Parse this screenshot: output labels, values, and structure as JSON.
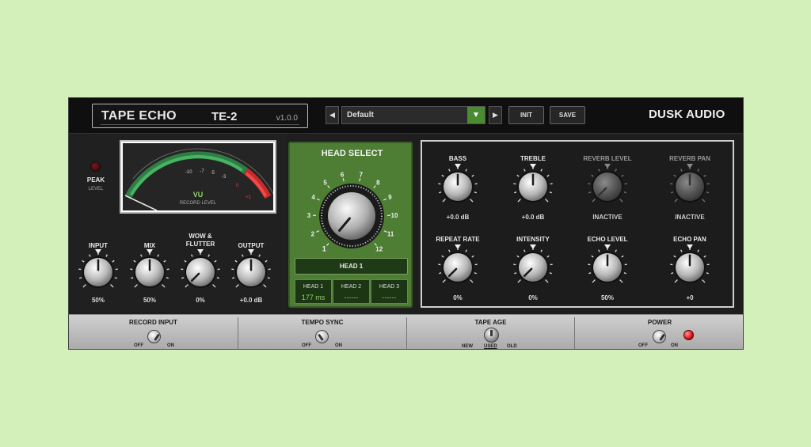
{
  "header": {
    "product_name": "TAPE ECHO",
    "model": "TE-2",
    "version": "v1.0.0",
    "preset_prev_icon": "◀",
    "preset_next_icon": "▶",
    "preset_name": "Default",
    "preset_dropdown_icon": "▼",
    "init_label": "INIT",
    "save_label": "SAVE",
    "brand": "DUSK AUDIO"
  },
  "meter": {
    "peak_label": "PEAK",
    "level_label": "LEVEL",
    "vu_label": "VU",
    "record_level_label": "RECORD LEVEL",
    "scale": [
      "-10",
      "-7",
      "-5",
      "-3",
      "0",
      "+1"
    ],
    "needle_level": 0.0
  },
  "left_knobs": [
    {
      "label": "INPUT",
      "value": "50%",
      "level": 0.5
    },
    {
      "label": "MIX",
      "value": "50%",
      "level": 0.5
    },
    {
      "label": "WOW &\nFLUTTER",
      "value": "0%",
      "level": 0.0
    },
    {
      "label": "OUTPUT",
      "value": "+0.0 dB",
      "level": 0.5
    }
  ],
  "head_select": {
    "title": "HEAD SELECT",
    "numbers": [
      "1",
      "2",
      "3",
      "4",
      "5",
      "6",
      "7",
      "8",
      "9",
      "10",
      "11",
      "12"
    ],
    "selected_label": "HEAD 1",
    "heads": [
      {
        "label": "HEAD 1",
        "value": "177 ms"
      },
      {
        "label": "HEAD 2",
        "value": "------"
      },
      {
        "label": "HEAD 3",
        "value": "------"
      }
    ]
  },
  "right_knobs": [
    {
      "label": "BASS",
      "value": "+0.0 dB",
      "level": 0.5,
      "active": true
    },
    {
      "label": "TREBLE",
      "value": "+0.0 dB",
      "level": 0.5,
      "active": true
    },
    {
      "label": "REVERB LEVEL",
      "value": "INACTIVE",
      "level": 0.0,
      "active": false
    },
    {
      "label": "REVERB PAN",
      "value": "INACTIVE",
      "level": 0.5,
      "active": false
    },
    {
      "label": "REPEAT RATE",
      "value": "0%",
      "level": 0.0,
      "active": true
    },
    {
      "label": "INTENSITY",
      "value": "0%",
      "level": 0.0,
      "active": true
    },
    {
      "label": "ECHO LEVEL",
      "value": "50%",
      "level": 0.5,
      "active": true
    },
    {
      "label": "ECHO PAN",
      "value": "+0",
      "level": 0.5,
      "active": true
    }
  ],
  "bottom": {
    "record_input": {
      "label": "RECORD INPUT",
      "off": "OFF",
      "on": "ON"
    },
    "tempo_sync": {
      "label": "TEMPO SYNC",
      "off": "OFF",
      "on": "ON"
    },
    "tape_age": {
      "label": "TAPE AGE",
      "new": "NEW",
      "used": "USED",
      "old": "OLD"
    },
    "power": {
      "label": "POWER",
      "off": "OFF",
      "on": "ON"
    }
  },
  "colors": {
    "accent_green": "#4e7d34",
    "meter_green": "#3fa85a",
    "meter_red": "#e03a3a",
    "power_led": "#e21a1a"
  }
}
